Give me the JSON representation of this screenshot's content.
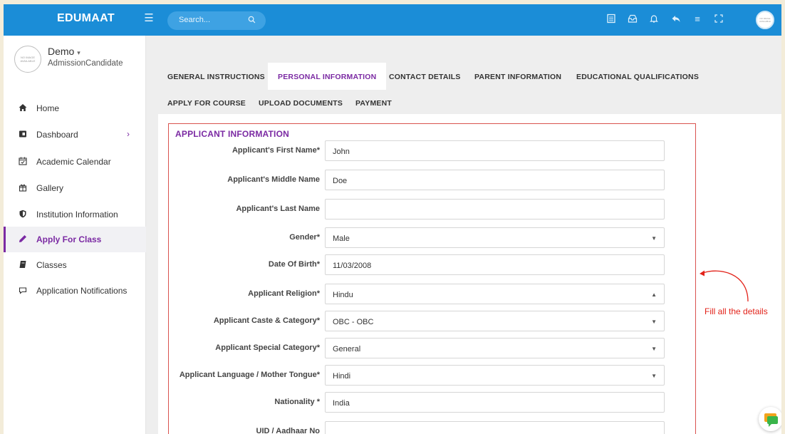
{
  "app": {
    "brand": "EDUMAAT"
  },
  "search": {
    "placeholder": "Search..."
  },
  "topbar": {
    "icons": [
      "list-icon",
      "inbox-icon",
      "bell-icon",
      "reply-icon",
      "menu-icon",
      "fullscreen-icon"
    ],
    "avatar_text": "NO IMAGE AVAILABLE"
  },
  "user": {
    "name": "Demo",
    "role": "AdmissionCandidate",
    "avatar_text": "NO IMAGE AVAILABLE"
  },
  "sidebar": {
    "items": [
      {
        "label": "Home",
        "icon": "home-icon"
      },
      {
        "label": "Dashboard",
        "icon": "dashboard-icon"
      },
      {
        "label": "Academic Calendar",
        "icon": "calendar-icon"
      },
      {
        "label": "Gallery",
        "icon": "gallery-icon"
      },
      {
        "label": "Institution Information",
        "icon": "shield-icon"
      },
      {
        "label": "Apply For Class",
        "icon": "pencil-icon"
      },
      {
        "label": "Classes",
        "icon": "book-icon"
      },
      {
        "label": "Application Notifications",
        "icon": "chat-icon"
      }
    ]
  },
  "tabs": [
    "GENERAL INSTRUCTIONS",
    "PERSONAL INFORMATION",
    "CONTACT DETAILS",
    "PARENT INFORMATION",
    "EDUCATIONAL QUALIFICATIONS",
    "APPLY FOR COURSE",
    "UPLOAD DOCUMENTS",
    "PAYMENT"
  ],
  "form": {
    "section_title": "APPLICANT INFORMATION",
    "fields": [
      {
        "label": "Applicant's First Name*",
        "value": "John"
      },
      {
        "label": "Applicant's Middle Name",
        "value": "Doe"
      },
      {
        "label": "Applicant's Last Name",
        "value": ""
      },
      {
        "label": "Gender*",
        "value": "Male"
      },
      {
        "label": "Date Of Birth*",
        "value": "11/03/2008"
      },
      {
        "label": "Applicant Religion*",
        "value": "Hindu"
      },
      {
        "label": "Applicant Caste & Category*",
        "value": "OBC - OBC"
      },
      {
        "label": "Applicant Special Category*",
        "value": "General"
      },
      {
        "label": "Applicant Language / Mother Tongue*",
        "value": "Hindi"
      },
      {
        "label": "Nationality *",
        "value": "India"
      },
      {
        "label": "UID / Aadhaar No",
        "value": ""
      }
    ]
  },
  "annotation": {
    "text": "Fill all the details",
    "color": "#e2231a"
  },
  "colors": {
    "topbar": "#1b8dd7",
    "accent": "#7b2aa3",
    "highlight_border": "#d9534f"
  }
}
